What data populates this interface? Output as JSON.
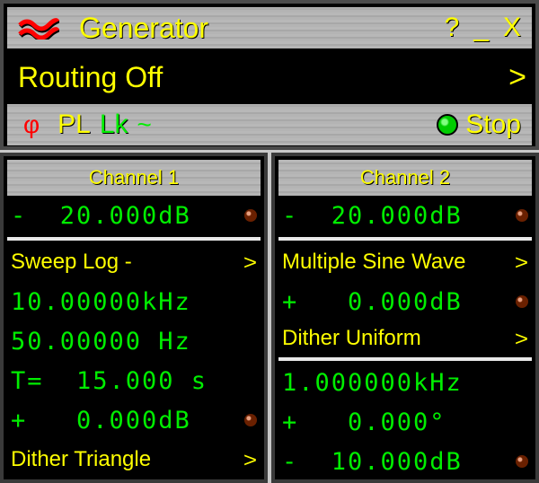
{
  "window": {
    "title": "Generator",
    "help": "?",
    "minimize": "_",
    "close": "X"
  },
  "routing": {
    "label": "Routing Off",
    "arrow": ">"
  },
  "status": {
    "pl": "PL",
    "lk": "Lk",
    "tilde": "~",
    "run_label": "Stop",
    "indicator_color": "#00cc00"
  },
  "channel1": {
    "title": "Channel 1",
    "level": "-  20.000dB",
    "waveform": "Sweep Log -",
    "start_freq": "10.00000kHz",
    "stop_freq": "50.00000 Hz",
    "time": "T=  15.000 s",
    "offset": "+   0.000dB",
    "dither": "Dither Triangle",
    "arrow": ">"
  },
  "channel2": {
    "title": "Channel 2",
    "level": "-  20.000dB",
    "waveform": "Multiple Sine Wave",
    "offset": "+   0.000dB",
    "dither": "Dither Uniform",
    "freq": "1.000000kHz",
    "phase": "+   0.000°",
    "amplitude": "-  10.000dB",
    "arrow": ">"
  }
}
